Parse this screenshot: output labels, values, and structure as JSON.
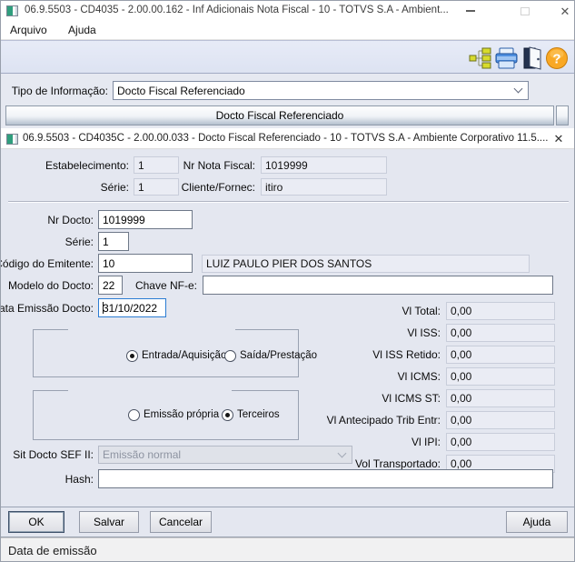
{
  "colors": {
    "focus_border": "#2b7cd3",
    "help_icon_orange": "#f9a825",
    "toolbar_bg": "#dde3f2",
    "dialog_bg": "#e4e7f0"
  },
  "window": {
    "title": "06.9.5503 - CD4035 - 2.00.00.162 - Inf Adicionais Nota Fiscal - 10 - TOTVS S.A - Ambient...",
    "menu": {
      "arquivo": "Arquivo",
      "ajuda": "Ajuda"
    },
    "toolbar_icons": {
      "hierarchy": "hierarchy-icon",
      "print": "print-icon",
      "exit": "exit-icon",
      "help": "help-icon"
    },
    "status_bar": "Data de emissão"
  },
  "info_type": {
    "label": "Tipo de Informação:",
    "value": "Docto Fiscal Referenciado"
  },
  "grid_header": "Docto Fiscal Referenciado",
  "dialog": {
    "title": "06.9.5503 - CD4035C - 2.00.00.033 - Docto Fiscal Referenciado - 10 - TOTVS S.A - Ambiente Corporativo 11.5....",
    "header_fields": {
      "estabelecimento": {
        "label": "Estabelecimento:",
        "value": "1"
      },
      "nr_nota_fiscal": {
        "label": "Nr Nota Fiscal:",
        "value": "1019999"
      },
      "serie": {
        "label": "Série:",
        "value": "1"
      },
      "cliente_fornec": {
        "label": "Cliente/Fornec:",
        "value": "itiro"
      }
    },
    "fields": {
      "nr_docto": {
        "label": "Nr Docto:",
        "value": "1019999"
      },
      "serie": {
        "label": "Série:",
        "value": "1"
      },
      "codigo_emitente": {
        "label": "Código do Emitente:",
        "value": "10",
        "description": "LUIZ PAULO PIER DOS SANTOS"
      },
      "modelo_docto": {
        "label": "Modelo do Docto:",
        "value": "22"
      },
      "chave_nfe": {
        "label": "Chave NF-e:",
        "value": ""
      },
      "data_emissao": {
        "label": "Data Emissão Docto:",
        "value": "31/10/2022",
        "focused": true
      },
      "sit_docto_sef": {
        "label": "Sit Docto SEF II:",
        "value": "Emissão normal",
        "disabled": true
      },
      "hash": {
        "label": "Hash:",
        "value": ""
      }
    },
    "radio_groups": {
      "movement": {
        "options": [
          {
            "label": "Entrada/Aquisição",
            "selected": true
          },
          {
            "label": "Saída/Prestação",
            "selected": false
          }
        ]
      },
      "emission": {
        "options": [
          {
            "label": "Emissão própria",
            "selected": false
          },
          {
            "label": "Terceiros",
            "selected": true
          }
        ]
      }
    },
    "values": [
      {
        "label": "Vl Total:",
        "value": "0,00"
      },
      {
        "label": "Vl ISS:",
        "value": "0,00"
      },
      {
        "label": "Vl ISS Retido:",
        "value": "0,00"
      },
      {
        "label": "Vl ICMS:",
        "value": "0,00"
      },
      {
        "label": "Vl ICMS ST:",
        "value": "0,00"
      },
      {
        "label": "Vl Antecipado Trib Entr:",
        "value": "0,00"
      },
      {
        "label": "Vl IPI:",
        "value": "0,00"
      },
      {
        "label": "Vol Transportado:",
        "value": "0,00"
      }
    ],
    "buttons": {
      "ok": "OK",
      "salvar": "Salvar",
      "cancelar": "Cancelar",
      "ajuda": "Ajuda"
    }
  }
}
